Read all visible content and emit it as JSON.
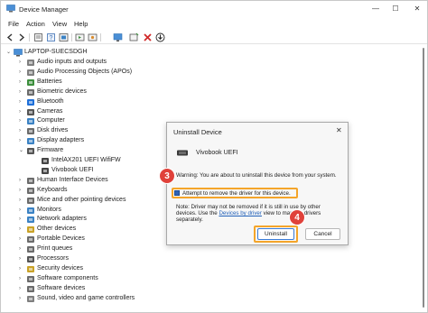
{
  "window": {
    "title": "Device Manager",
    "controls": {
      "minimize": "—",
      "maximize": "☐",
      "close": "✕"
    }
  },
  "menu": [
    "File",
    "Action",
    "View",
    "Help"
  ],
  "toolbar": {
    "icons": [
      "back-icon",
      "forward-icon",
      "properties-icon",
      "help-icon",
      "update-driver-icon",
      "scan-icon",
      "monitor-icon",
      "add-hardware-icon",
      "disable-icon",
      "download-icon"
    ]
  },
  "tree": {
    "root": "LAPTOP-SUECSDGH",
    "items": [
      {
        "label": "Audio inputs and outputs",
        "chevron": "›",
        "icon": "speaker-icon",
        "color": "#7f7f7f"
      },
      {
        "label": "Audio Processing Objects (APOs)",
        "chevron": "›",
        "icon": "speaker-icon",
        "color": "#7f7f7f"
      },
      {
        "label": "Batteries",
        "chevron": "›",
        "icon": "battery-icon",
        "color": "#3d8f3d"
      },
      {
        "label": "Biometric devices",
        "chevron": "›",
        "icon": "fingerprint-icon",
        "color": "#6b6b6b"
      },
      {
        "label": "Bluetooth",
        "chevron": "›",
        "icon": "bluetooth-icon",
        "color": "#1e6fd9"
      },
      {
        "label": "Cameras",
        "chevron": "›",
        "icon": "camera-icon",
        "color": "#555555"
      },
      {
        "label": "Computer",
        "chevron": "›",
        "icon": "computer-icon",
        "color": "#3b82c4"
      },
      {
        "label": "Disk drives",
        "chevron": "›",
        "icon": "disk-icon",
        "color": "#6b6b6b"
      },
      {
        "label": "Display adapters",
        "chevron": "›",
        "icon": "display-icon",
        "color": "#3b82c4"
      },
      {
        "label": "Firmware",
        "chevron": "⌄",
        "icon": "firmware-icon",
        "color": "#555555"
      },
      {
        "label": "IntelAX201 UEFI WifiFW",
        "chevron": "",
        "icon": "chip-icon",
        "color": "#444444",
        "child": true
      },
      {
        "label": "Vivobook UEFI",
        "chevron": "",
        "icon": "chip-icon",
        "color": "#444444",
        "child": true
      },
      {
        "label": "Human Interface Devices",
        "chevron": "›",
        "icon": "hid-icon",
        "color": "#6b6b6b"
      },
      {
        "label": "Keyboards",
        "chevron": "›",
        "icon": "keyboard-icon",
        "color": "#6b6b6b"
      },
      {
        "label": "Mice and other pointing devices",
        "chevron": "›",
        "icon": "mouse-icon",
        "color": "#6b6b6b"
      },
      {
        "label": "Monitors",
        "chevron": "›",
        "icon": "monitor-icon",
        "color": "#3b82c4"
      },
      {
        "label": "Network adapters",
        "chevron": "›",
        "icon": "network-icon",
        "color": "#3b82c4"
      },
      {
        "label": "Other devices",
        "chevron": "›",
        "icon": "unknown-device-icon",
        "color": "#c9a227"
      },
      {
        "label": "Portable Devices",
        "chevron": "›",
        "icon": "portable-icon",
        "color": "#6b6b6b"
      },
      {
        "label": "Print queues",
        "chevron": "›",
        "icon": "printer-icon",
        "color": "#6b6b6b"
      },
      {
        "label": "Processors",
        "chevron": "›",
        "icon": "cpu-icon",
        "color": "#555555"
      },
      {
        "label": "Security devices",
        "chevron": "›",
        "icon": "security-icon",
        "color": "#c9a227"
      },
      {
        "label": "Software components",
        "chevron": "›",
        "icon": "component-icon",
        "color": "#6b6b6b"
      },
      {
        "label": "Software devices",
        "chevron": "›",
        "icon": "component-icon",
        "color": "#6b6b6b"
      },
      {
        "label": "Sound, video and game controllers",
        "chevron": "›",
        "icon": "speaker-icon",
        "color": "#7f7f7f"
      }
    ]
  },
  "dialog": {
    "title": "Uninstall Device",
    "close": "✕",
    "device_name": "Vivobook UEFI",
    "warning": "Warning: You are about to uninstall this device from your system.",
    "checkbox_label": "Attempt to remove the driver for this device.",
    "checkbox_checked": true,
    "note_before": "Note: Driver may not be removed if it is still in use by other devices. Use the ",
    "note_link": "Devices by driver",
    "note_after": " view to manage drivers separately.",
    "uninstall_label": "Uninstall",
    "cancel_label": "Cancel"
  },
  "callouts": [
    "3",
    "4"
  ],
  "colors": {
    "highlight": "#f4a52a",
    "badge": "#e0413a",
    "accent": "#3a7bd5"
  }
}
